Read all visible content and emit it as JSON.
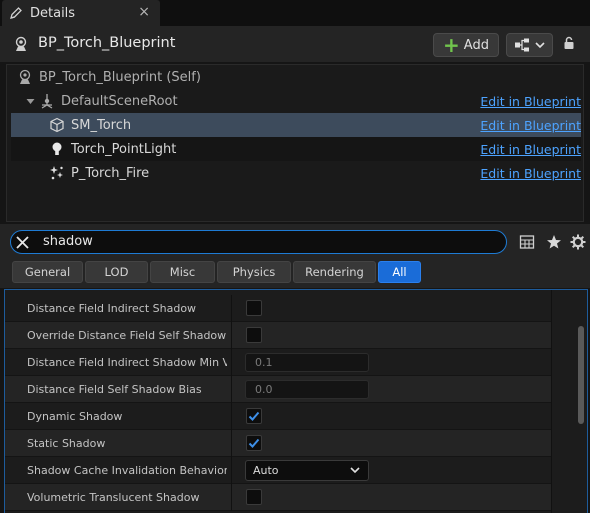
{
  "tab": {
    "label": "Details",
    "close": "×"
  },
  "header": {
    "title": "BP_Torch_Blueprint",
    "add_label": "Add"
  },
  "tree": {
    "self_label": "BP_Torch_Blueprint (Self)",
    "edit_label": "Edit in Blueprint",
    "items": [
      {
        "label": "DefaultSceneRoot",
        "icon": "scene-root-icon"
      },
      {
        "label": "SM_Torch",
        "icon": "static-mesh-icon"
      },
      {
        "label": "Torch_PointLight",
        "icon": "light-bulb-icon"
      },
      {
        "label": "P_Torch_Fire",
        "icon": "particle-icon"
      }
    ]
  },
  "search": {
    "value": "shadow"
  },
  "filters": [
    "General",
    "LOD",
    "Misc",
    "Physics",
    "Rendering",
    "All"
  ],
  "properties": [
    {
      "name": "Distance Field Indirect Shadow",
      "type": "checkbox",
      "checked": false
    },
    {
      "name": "Override Distance Field Self Shadow Bias",
      "type": "checkbox",
      "checked": false
    },
    {
      "name": "Distance Field Indirect Shadow Min Visibility",
      "type": "number",
      "value": "0.1"
    },
    {
      "name": "Distance Field Self Shadow Bias",
      "type": "number",
      "value": "0.0"
    },
    {
      "name": "Dynamic Shadow",
      "type": "checkbox",
      "checked": true
    },
    {
      "name": "Static Shadow",
      "type": "checkbox",
      "checked": true
    },
    {
      "name": "Shadow Cache Invalidation Behavior",
      "type": "dropdown",
      "value": "Auto"
    },
    {
      "name": "Volumetric Translucent Shadow",
      "type": "checkbox",
      "checked": false
    }
  ],
  "colors": {
    "accent": "#1a6cd8",
    "link": "#4da3ff",
    "add_plus": "#71c44d",
    "selected_row": "#3d4b5c"
  }
}
